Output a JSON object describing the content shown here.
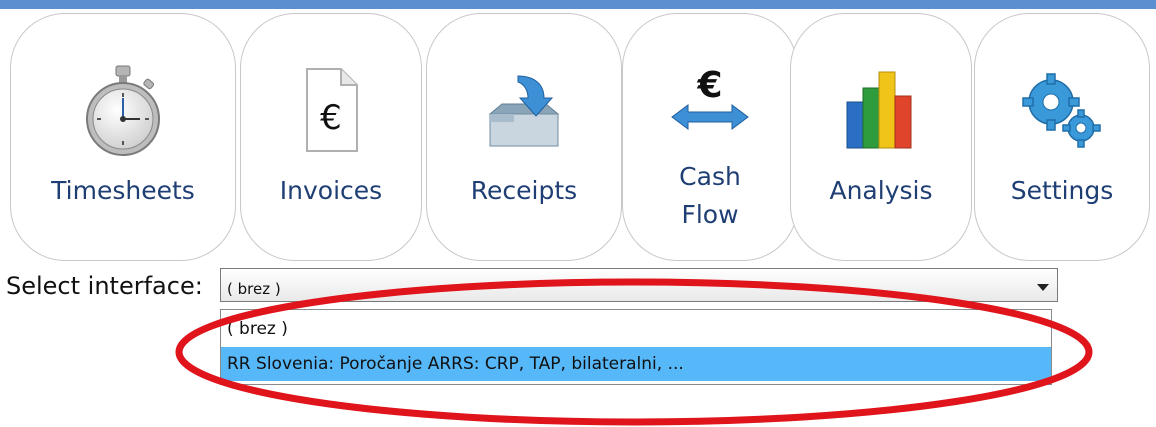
{
  "colors": {
    "top_bar": "#5b8fcf",
    "tile_label": "#1f3f74",
    "selected_option": "#56b7f9",
    "annotation_ellipse": "#e0141b"
  },
  "tiles": [
    {
      "label": "Timesheets",
      "icon": "stopwatch-icon"
    },
    {
      "label": "Invoices",
      "icon": "euro-invoice-icon",
      "symbol": "€"
    },
    {
      "label": "Receipts",
      "icon": "inbox-arrow-icon"
    },
    {
      "label_line1": "Cash",
      "label_line2": "Flow",
      "icon": "euro-transfer-icon",
      "symbol": "€"
    },
    {
      "label": "Analysis",
      "icon": "bar-chart-icon"
    },
    {
      "label": "Settings",
      "icon": "gears-icon"
    }
  ],
  "interface_select": {
    "label": "Select interface:",
    "value": "( brez )",
    "options": [
      "( brez )",
      "RR Slovenia: Poročanje ARRS: CRP, TAP, bilateralni, ..."
    ],
    "highlighted_option_index": 1
  }
}
